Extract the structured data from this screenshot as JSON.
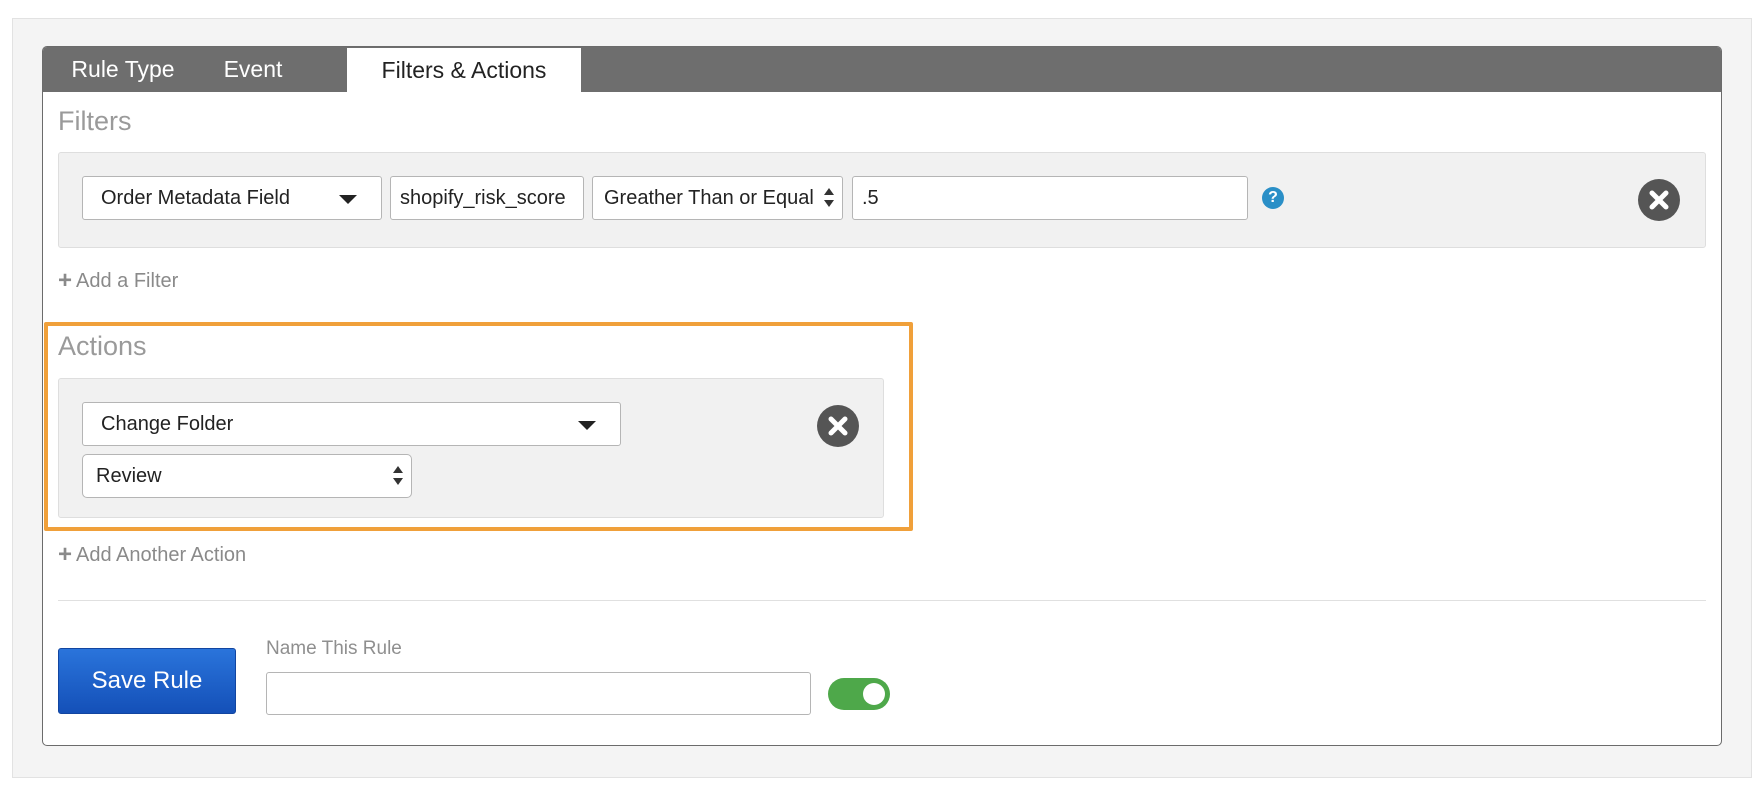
{
  "tabs": [
    {
      "label": "Rule Type",
      "active": false
    },
    {
      "label": "Event",
      "active": false
    },
    {
      "label": "Filters & Actions",
      "active": true
    }
  ],
  "filters": {
    "title": "Filters",
    "row": {
      "field_select": "Order Metadata Field",
      "key_value": "shopify_risk_score",
      "operator_select": "Greather Than or Equal",
      "value": ".5",
      "help_icon": "?"
    },
    "add_label": "Add a Filter"
  },
  "actions": {
    "title": "Actions",
    "row": {
      "action_select": "Change Folder",
      "folder_select": "Review"
    },
    "add_label": "Add Another Action",
    "highlight_color": "#f0a03a"
  },
  "footer": {
    "save_label": "Save Rule",
    "name_label": "Name This Rule",
    "name_value": "",
    "enabled": true
  },
  "colors": {
    "tabbar": "#6e6e6e",
    "save_button": "#1f63c9",
    "toggle_on": "#4ea84a",
    "help_icon": "#2a8fc7"
  }
}
